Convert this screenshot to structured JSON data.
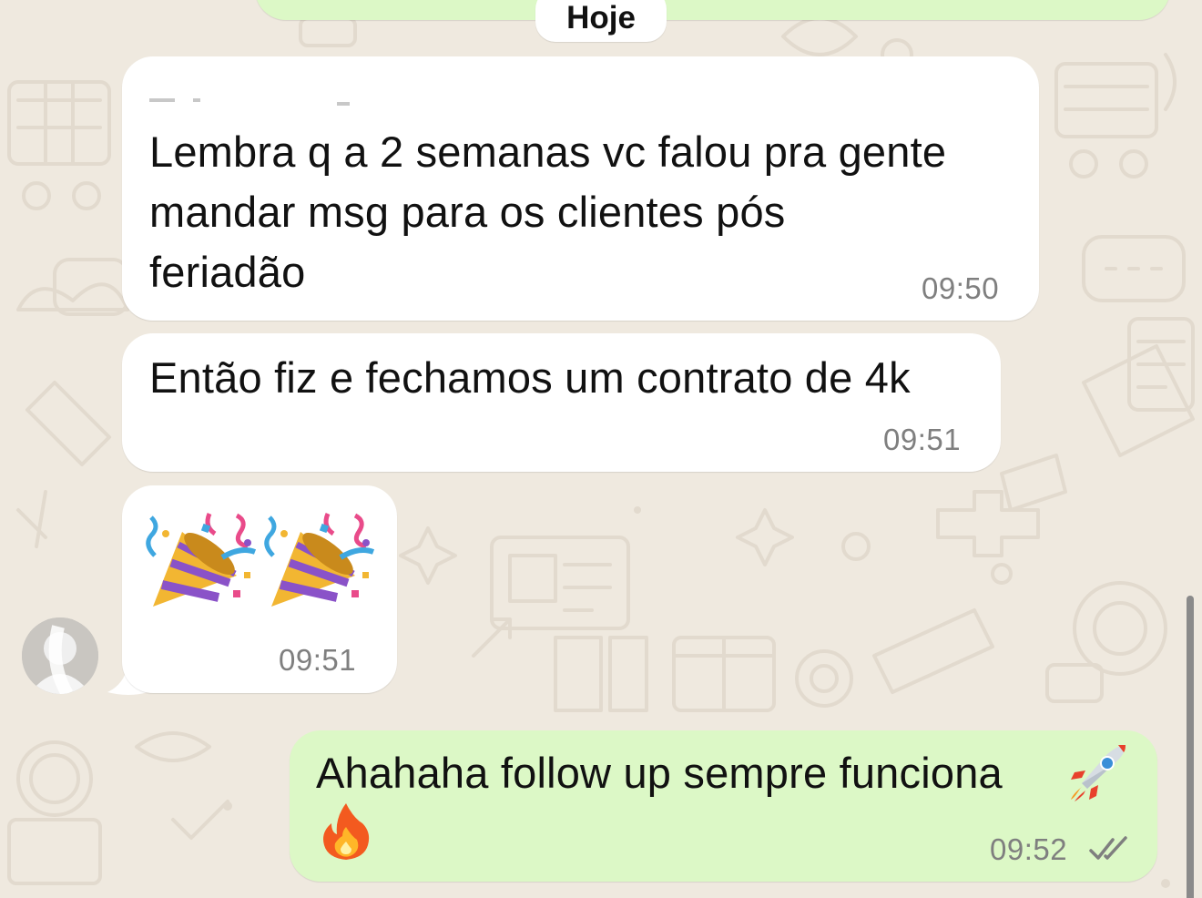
{
  "chat": {
    "date_divider": "Hoje",
    "messages": [
      {
        "direction": "incoming",
        "text": "Lembra q a 2 semanas vc falou pra gente\nmandar msg para os clientes pós\nferiadão",
        "time": "09:50"
      },
      {
        "direction": "incoming",
        "text": "Então fiz e fechamos um contrato de 4k",
        "time": "09:51"
      },
      {
        "direction": "incoming",
        "emoji": [
          "party-popper",
          "party-popper"
        ],
        "time": "09:51"
      },
      {
        "direction": "outgoing",
        "text": "Ahahaha follow up sempre funciona",
        "emoji": [
          "rocket",
          "fire"
        ],
        "time": "09:52",
        "status": "read-double-check"
      }
    ]
  },
  "colors": {
    "wallpaper": "#efe9df",
    "incoming_bubble": "#ffffff",
    "outgoing_bubble": "#dcf8c6",
    "timestamp": "#7f7f7f",
    "read_check": "#7f7f7f"
  }
}
